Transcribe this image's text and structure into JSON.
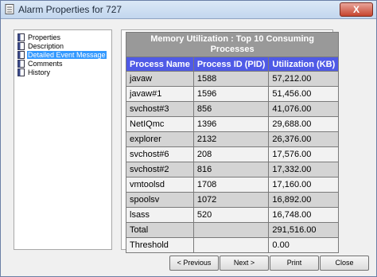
{
  "window": {
    "title": "Alarm Properties for 727",
    "close_glyph": "X"
  },
  "tree": {
    "items": [
      {
        "label": "Properties",
        "selected": false
      },
      {
        "label": "Description",
        "selected": false
      },
      {
        "label": "Detailed Event Message",
        "selected": true
      },
      {
        "label": "Comments",
        "selected": false
      },
      {
        "label": "History",
        "selected": false
      }
    ]
  },
  "report": {
    "title": "Memory Utilization : Top 10 Consuming Processes",
    "columns": [
      "Process Name",
      "Process ID (PID)",
      "Utilization (KB)"
    ],
    "rows": [
      [
        "javaw",
        "1588",
        "57,212.00"
      ],
      [
        "javaw#1",
        "1596",
        "51,456.00"
      ],
      [
        "svchost#3",
        "856",
        "41,076.00"
      ],
      [
        "NetIQmc",
        "1396",
        "29,688.00"
      ],
      [
        "explorer",
        "2132",
        "26,376.00"
      ],
      [
        "svchost#6",
        "208",
        "17,576.00"
      ],
      [
        "svchost#2",
        "816",
        "17,332.00"
      ],
      [
        "vmtoolsd",
        "1708",
        "17,160.00"
      ],
      [
        "spoolsv",
        "1072",
        "16,892.00"
      ],
      [
        "lsass",
        "520",
        "16,748.00"
      ],
      [
        "Total",
        "",
        "291,516.00"
      ],
      [
        "Threshold",
        "",
        "0.00"
      ]
    ]
  },
  "buttons": {
    "previous": "< Previous",
    "next": "Next >",
    "print": "Print",
    "close": "Close"
  }
}
